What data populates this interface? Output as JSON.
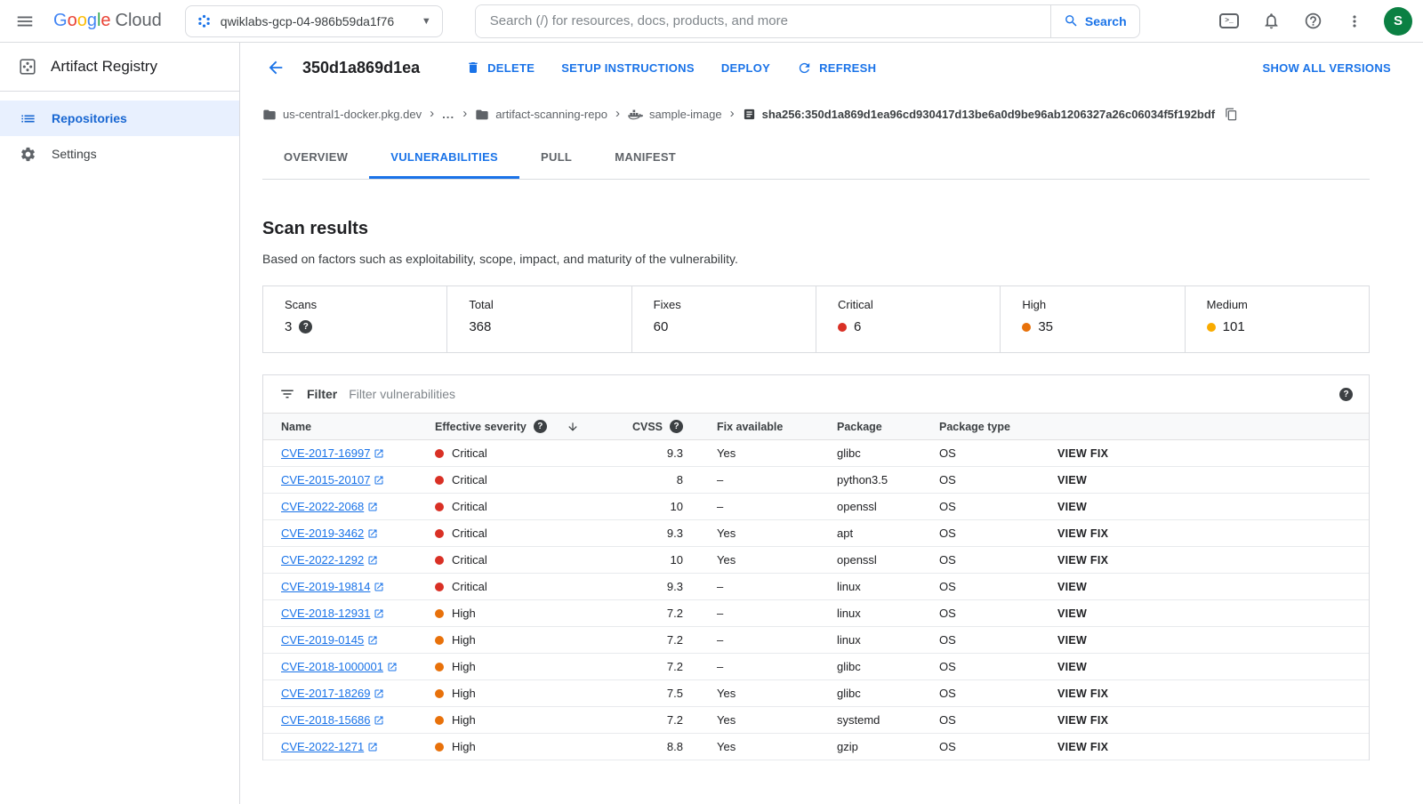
{
  "topbar": {
    "logo_google": "Google",
    "logo_google_colors": [
      "#4285F4",
      "#EA4335",
      "#FBBC05",
      "#4285F4",
      "#34A853",
      "#EA4335"
    ],
    "logo_cloud": "Cloud",
    "project_name": "qwiklabs-gcp-04-986b59da1f76",
    "search_placeholder": "Search (/) for resources, docs, products, and more",
    "search_button_label": "Search",
    "avatar_letter": "S"
  },
  "sidebar": {
    "product_title": "Artifact Registry",
    "items": [
      {
        "label": "Repositories",
        "selected": true
      },
      {
        "label": "Settings",
        "selected": false
      }
    ]
  },
  "page_header": {
    "title": "350d1a869d1ea",
    "delete_label": "DELETE",
    "setup_instructions_label": "SETUP INSTRUCTIONS",
    "deploy_label": "DEPLOY",
    "refresh_label": "REFRESH",
    "show_all_versions_label": "SHOW ALL VERSIONS"
  },
  "breadcrumb": {
    "registry_host": "us-central1-docker.pkg.dev",
    "ellipsis": "...",
    "repository": "artifact-scanning-repo",
    "image": "sample-image",
    "digest": "sha256:350d1a869d1ea96cd930417d13be6a0d9be96ab1206327a26c06034f5f192bdf"
  },
  "tabs": [
    {
      "label": "OVERVIEW",
      "selected": false
    },
    {
      "label": "VULNERABILITIES",
      "selected": true
    },
    {
      "label": "PULL",
      "selected": false
    },
    {
      "label": "MANIFEST",
      "selected": false
    }
  ],
  "scan_results": {
    "title": "Scan results",
    "subtitle": "Based on factors such as exploitability, scope, impact, and maturity of the vulnerability.",
    "stats": [
      {
        "label": "Scans",
        "value": "3",
        "help": true
      },
      {
        "label": "Total",
        "value": "368"
      },
      {
        "label": "Fixes",
        "value": "60"
      },
      {
        "label": "Critical",
        "value": "6",
        "dot_color": "#d93025"
      },
      {
        "label": "High",
        "value": "35",
        "dot_color": "#e8710a"
      },
      {
        "label": "Medium",
        "value": "101",
        "dot_color": "#f9ab00"
      }
    ]
  },
  "filter_bar": {
    "label": "Filter",
    "placeholder": "Filter vulnerabilities"
  },
  "vulnerability_table": {
    "columns": {
      "name": "Name",
      "severity": "Effective severity",
      "cvss": "CVSS",
      "fix": "Fix available",
      "package": "Package",
      "package_type": "Package type"
    },
    "severity_colors": {
      "Critical": "#d93025",
      "High": "#e8710a",
      "Medium": "#f9ab00"
    },
    "rows": [
      {
        "name": "CVE-2017-16997",
        "severity": "Critical",
        "cvss": "9.3",
        "fix": "Yes",
        "package": "glibc",
        "package_type": "OS",
        "action": "VIEW FIX"
      },
      {
        "name": "CVE-2015-20107",
        "severity": "Critical",
        "cvss": "8",
        "fix": "–",
        "package": "python3.5",
        "package_type": "OS",
        "action": "VIEW"
      },
      {
        "name": "CVE-2022-2068",
        "severity": "Critical",
        "cvss": "10",
        "fix": "–",
        "package": "openssl",
        "package_type": "OS",
        "action": "VIEW"
      },
      {
        "name": "CVE-2019-3462",
        "severity": "Critical",
        "cvss": "9.3",
        "fix": "Yes",
        "package": "apt",
        "package_type": "OS",
        "action": "VIEW FIX"
      },
      {
        "name": "CVE-2022-1292",
        "severity": "Critical",
        "cvss": "10",
        "fix": "Yes",
        "package": "openssl",
        "package_type": "OS",
        "action": "VIEW FIX"
      },
      {
        "name": "CVE-2019-19814",
        "severity": "Critical",
        "cvss": "9.3",
        "fix": "–",
        "package": "linux",
        "package_type": "OS",
        "action": "VIEW"
      },
      {
        "name": "CVE-2018-12931",
        "severity": "High",
        "cvss": "7.2",
        "fix": "–",
        "package": "linux",
        "package_type": "OS",
        "action": "VIEW"
      },
      {
        "name": "CVE-2019-0145",
        "severity": "High",
        "cvss": "7.2",
        "fix": "–",
        "package": "linux",
        "package_type": "OS",
        "action": "VIEW"
      },
      {
        "name": "CVE-2018-1000001",
        "severity": "High",
        "cvss": "7.2",
        "fix": "–",
        "package": "glibc",
        "package_type": "OS",
        "action": "VIEW"
      },
      {
        "name": "CVE-2017-18269",
        "severity": "High",
        "cvss": "7.5",
        "fix": "Yes",
        "package": "glibc",
        "package_type": "OS",
        "action": "VIEW FIX"
      },
      {
        "name": "CVE-2018-15686",
        "severity": "High",
        "cvss": "7.2",
        "fix": "Yes",
        "package": "systemd",
        "package_type": "OS",
        "action": "VIEW FIX"
      },
      {
        "name": "CVE-2022-1271",
        "severity": "High",
        "cvss": "8.8",
        "fix": "Yes",
        "package": "gzip",
        "package_type": "OS",
        "action": "VIEW FIX"
      }
    ]
  }
}
